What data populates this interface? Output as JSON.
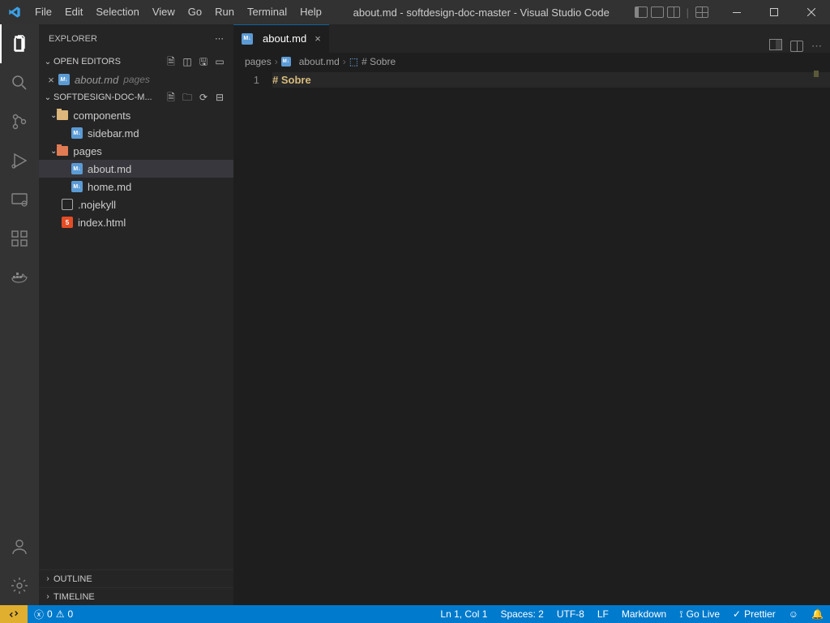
{
  "title_bar": {
    "menus": [
      "File",
      "Edit",
      "Selection",
      "View",
      "Go",
      "Run",
      "Terminal",
      "Help"
    ],
    "title": "about.md - softdesign-doc-master - Visual Studio Code"
  },
  "activity_bar": {
    "items": [
      "explorer",
      "search",
      "source-control",
      "run-debug",
      "remote",
      "extensions",
      "docker"
    ],
    "bottom": [
      "account",
      "settings"
    ]
  },
  "sidebar": {
    "title": "EXPLORER",
    "open_editors_label": "OPEN EDITORS",
    "open_editors": [
      {
        "name": "about.md",
        "path": "pages"
      }
    ],
    "workspace_label": "SOFTDESIGN-DOC-M...",
    "tree": {
      "components": {
        "label": "components",
        "children": [
          {
            "name": "sidebar.md",
            "icon": "md"
          }
        ]
      },
      "pages": {
        "label": "pages",
        "children": [
          {
            "name": "about.md",
            "icon": "md",
            "active": true
          },
          {
            "name": "home.md",
            "icon": "md"
          }
        ]
      },
      "root_files": [
        {
          "name": ".nojekyll",
          "icon": "file"
        },
        {
          "name": "index.html",
          "icon": "html"
        }
      ]
    },
    "outline_label": "OUTLINE",
    "timeline_label": "TIMELINE"
  },
  "editor": {
    "tab": {
      "name": "about.md"
    },
    "breadcrumbs": [
      "pages",
      "about.md",
      "# Sobre"
    ],
    "lines": [
      {
        "num": "1",
        "content": "# Sobre"
      }
    ]
  },
  "status": {
    "errors": "0",
    "warnings": "0",
    "cursor": "Ln 1, Col 1",
    "spaces": "Spaces: 2",
    "encoding": "UTF-8",
    "eol": "LF",
    "lang": "Markdown",
    "golive": "Go Live",
    "prettier": "Prettier"
  }
}
